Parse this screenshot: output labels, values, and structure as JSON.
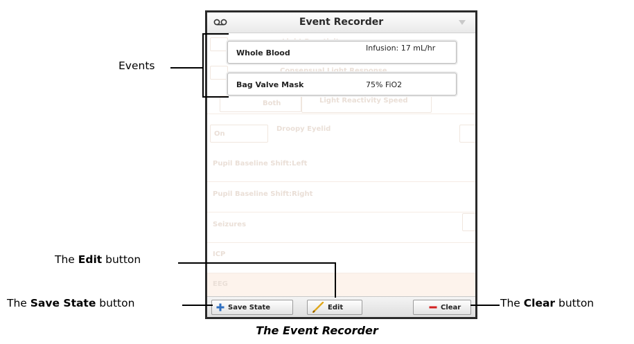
{
  "window": {
    "title": "Event Recorder"
  },
  "events": [
    {
      "name": "Whole Blood",
      "value": "Infusion: 17 mL/hr"
    },
    {
      "name": "Bag Valve Mask",
      "value": "75% FiO2"
    }
  ],
  "background": {
    "ghost_texts": [
      "Light Reactivity",
      "Consensual Light Response",
      "Both",
      "Light Reactivity Speed",
      "On",
      "Droopy Eyelid",
      "Pupil Baseline Shift:Left",
      "Pupil Baseline Shift:Right",
      "Seizures",
      "ICP",
      "EEG"
    ]
  },
  "footer": {
    "save_state_label": "Save State",
    "edit_label": "Edit",
    "clear_label": "Clear"
  },
  "callouts": {
    "events": "Events",
    "edit_prefix": "The ",
    "edit_bold": "Edit",
    "edit_suffix": " button",
    "save_prefix": "The ",
    "save_bold": "Save State",
    "save_suffix": " button",
    "clear_prefix": "The ",
    "clear_bold": "Clear",
    "clear_suffix": " button"
  },
  "caption": "The Event Recorder",
  "icons": {
    "title": "voicemail-icon",
    "menu": "dropdown-triangle-icon",
    "save": "plus-icon",
    "edit": "pencil-icon",
    "clear": "minus-icon"
  },
  "colors": {
    "save_plus": "#2f6fc0",
    "edit_pencil": "#e0a81c",
    "clear_minus": "#d32020",
    "panel_border": "#2a2a2a"
  }
}
